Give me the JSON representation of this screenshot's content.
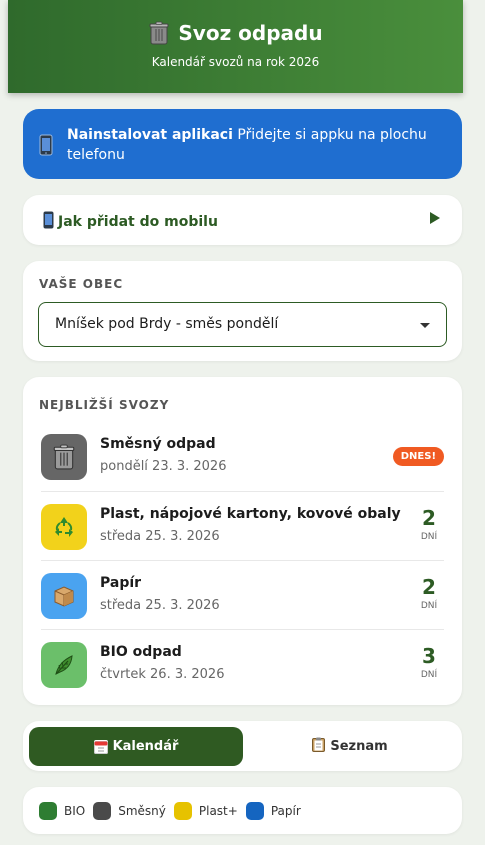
{
  "header": {
    "title": "Svoz odpadu",
    "subtitle": "Kalendář svozů na rok 2026",
    "icon": "trash-bin-icon",
    "gradient": [
      "#2f6a2c",
      "#4a8f3c"
    ]
  },
  "install": {
    "bold": "Nainstalovat aplikaci",
    "text": "Přidejte si appku na plochu telefonu",
    "icon": "phone-icon",
    "color": "#1f6ed0"
  },
  "howto": {
    "label": "Jak přidat do mobilu",
    "icon": "phone-icon"
  },
  "obec": {
    "label": "VAŠE OBEC",
    "selected": "Mníšek pod Brdy - směs pondělí"
  },
  "next": {
    "label": "NEJBLIŽŠÍ SVOZY",
    "items": [
      {
        "name": "Směsný odpad",
        "date": "pondělí 23. 3. 2026",
        "badge": "DNES!",
        "icon": "trash-bin-icon",
        "color": "#666666"
      },
      {
        "name": "Plast, nápojové kartony, kovové obaly",
        "date": "středa 25. 3. 2026",
        "days": "2",
        "unit": "DNÍ",
        "icon": "recycle-icon",
        "color": "#f2d21b"
      },
      {
        "name": "Papír",
        "date": "středa 25. 3. 2026",
        "days": "2",
        "unit": "DNÍ",
        "icon": "box-icon",
        "color": "#4aa3f0"
      },
      {
        "name": "BIO odpad",
        "date": "čtvrtek 26. 3. 2026",
        "days": "3",
        "unit": "DNÍ",
        "icon": "leaf-icon",
        "color": "#6bbf6a"
      }
    ]
  },
  "toggle": {
    "calendar": "Kalendář",
    "list": "Seznam"
  },
  "legend": [
    {
      "label": "BIO",
      "color": "#2e7d32"
    },
    {
      "label": "Směsný",
      "color": "#4a4a4a"
    },
    {
      "label": "Plast+",
      "color": "#e6c200"
    },
    {
      "label": "Papír",
      "color": "#1565c0"
    }
  ],
  "accent": "#2d5b24",
  "badge_color": "#f05a22"
}
